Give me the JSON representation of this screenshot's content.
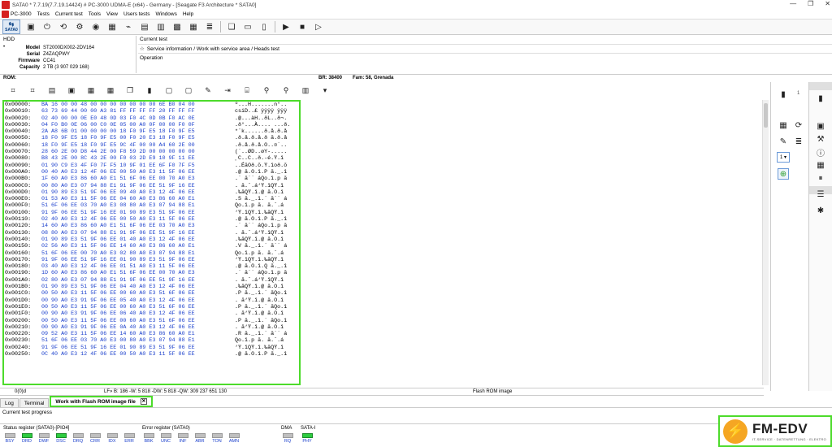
{
  "window": {
    "title": "SATA0 * 7.7.19(7.7.19.14424) # PC-3000 UDMA-E (x64) - Germany - [Seagate F3 Architecture * SATA0]",
    "controls": [
      "—",
      "❐",
      "✕"
    ]
  },
  "menu": {
    "logo_label": "PC-3000",
    "items": [
      "Tests",
      "Current test",
      "Tools",
      "View",
      "Users tests",
      "Windows",
      "Help"
    ]
  },
  "toolbar": {
    "sata_label": "SATA0"
  },
  "drive": {
    "section": "HDD",
    "model_label": "Model",
    "model": "ST2000DX002-2DV164",
    "serial_label": "Serial",
    "serial": "Z4ZAQPWY",
    "firmware_label": "Firmware",
    "firmware": "CC41",
    "capacity_label": "Capacity",
    "capacity": "2 TB (3 907 029 168)"
  },
  "current_test": {
    "label": "Current test",
    "path": "Service information / Work with service area / Heads test",
    "operation_label": "Operation"
  },
  "rom_bar": {
    "label": "ROM:",
    "br": "BR: 38400",
    "fam": "Fam: 58, Grenada"
  },
  "hex": {
    "rows": [
      {
        "addr": "0x00000:",
        "bytes": "BA 16 00 00 48 00 00 00 00 00 00 00 6E B0 04 00",
        "ascii": "º...H.......n°.."
      },
      {
        "addr": "0x00010:",
        "bytes": "63 73 69 44 00 00 A3 81 FF FF FF FF 20 FF FF FF",
        "ascii": "csiD..£ ÿÿÿÿ ÿÿÿ"
      },
      {
        "addr": "0x00020:",
        "bytes": "02 40 00 00 0E E0 48 0D 03 F0 4C 0D 0B F0 AC 0E",
        "ascii": ".@...àH..ðL..ð¬."
      },
      {
        "addr": "0x00030:",
        "bytes": "04 F0 B0 0E 06 00 C0 0E 05 00 A0 0F 00 00 F0 0F",
        "ascii": ".ð°...À.... ...ð."
      },
      {
        "addr": "0x00040:",
        "bytes": "2A A8 6B 01 00 00 00 00 18 F0 9F E5 18 F0 9F E5",
        "ascii": "*¨k......ð.å.ð.å"
      },
      {
        "addr": "0x00050:",
        "bytes": "18 F0 9F E5 18 F0 9F E5 00 F0 20 E3 18 F0 9F E5",
        "ascii": ".ð.å.ð.å.ð ã.ð.å"
      },
      {
        "addr": "0x00060:",
        "bytes": "18 F0 9F E5 18 F0 9F E5 9C 4F 00 00 A4 60 2E 00",
        "ascii": ".ð.å.ð.å.O..¤`.."
      },
      {
        "addr": "0x00070:",
        "bytes": "28 60 2E 00 D8 44 2E 00 F8 59 2D 00 00 00 00 00",
        "ascii": "(`..ØD..øY-....."
      },
      {
        "addr": "0x00080:",
        "bytes": "B8 43 2E 00 8C 43 2E 00 F0 03 2D E9 10 9F 11 EE",
        "ascii": "¸C..C..ð.-é.Ÿ.î"
      },
      {
        "addr": "0x00090:",
        "bytes": "01 90 C9 E3 4F F0 7F F5 10 9F 01 EE 6F F0 7F F5",
        "ascii": "..ÉãOð.õ.Ÿ.îoð.õ"
      },
      {
        "addr": "0x000A0:",
        "bytes": "00 40 A0 E3 12 4F 06 EE 00 50 A0 E3 11 5F 06 EE",
        "ascii": ".@ ã.O.î.P ã._.î"
      },
      {
        "addr": "0x000B0:",
        "bytes": "1F 60 A0 E3 86 60 A0 E1 51 6F 06 EE 00 70 A0 E3",
        "ascii": ".` ã`` áQo.î.p ã"
      },
      {
        "addr": "0x000C0:",
        "bytes": "00 80 A0 E3 07 94 88 E1 91 9F 06 EE 51 9F 16 EE",
        "ascii": ". ã.ˆ.á‘Ÿ.îQŸ.î"
      },
      {
        "addr": "0x000D0:",
        "bytes": "01 90 89 E3 51 9F 06 EE 09 40 A0 E3 12 4F 06 EE",
        "ascii": ".‰ãQŸ.î.@ ã.O.î"
      },
      {
        "addr": "0x000E0:",
        "bytes": "01 53 A0 E3 11 5F 06 EE 04 60 A0 E3 86 60 A0 E1",
        "ascii": ".S ã._.î.` ã`` á"
      },
      {
        "addr": "0x000F0:",
        "bytes": "51 6F 06 EE 03 70 A0 E3 08 80 A0 E3 07 94 88 E1",
        "ascii": "Qo.î.p ã. ã.ˆ.á"
      },
      {
        "addr": "0x00100:",
        "bytes": "91 9F 06 EE 51 9F 16 EE 01 90 89 E3 51 9F 06 EE",
        "ascii": "‘Ÿ.îQŸ.î.‰ãQŸ.î"
      },
      {
        "addr": "0x00110:",
        "bytes": "02 40 A0 E3 12 4F 06 EE 00 50 A0 E3 11 5F 06 EE",
        "ascii": ".@ ã.O.î.P ã._.î"
      },
      {
        "addr": "0x00120:",
        "bytes": "14 60 A0 E3 86 60 A0 E1 51 6F 06 EE 03 70 A0 E3",
        "ascii": ".` ã`` áQo.î.p ã"
      },
      {
        "addr": "0x00130:",
        "bytes": "08 80 A0 E3 07 94 88 E1 91 9F 06 EE 51 9F 16 EE",
        "ascii": ". ã.ˆ.á‘Ÿ.îQŸ.î"
      },
      {
        "addr": "0x00140:",
        "bytes": "01 90 89 E3 51 9F 06 EE 01 40 A0 E3 12 4F 06 EE",
        "ascii": ".‰ãQŸ.î.@ ã.O.î"
      },
      {
        "addr": "0x00150:",
        "bytes": "02 56 A0 E3 11 5F 06 EE 14 60 A0 E3 86 60 A0 E1",
        "ascii": ".V ã._.î.` ã`` á"
      },
      {
        "addr": "0x00160:",
        "bytes": "51 6F 06 EE 00 70 A0 E3 02 80 A0 E3 07 94 88 E1",
        "ascii": "Qo.î.p ã. ã.ˆ.á"
      },
      {
        "addr": "0x00170:",
        "bytes": "91 9F 06 EE 51 9F 16 EE 01 90 89 E3 51 9F 06 EE",
        "ascii": "‘Ÿ.îQŸ.î.‰ãQŸ.î"
      },
      {
        "addr": "0x00180:",
        "bytes": "03 40 A0 E3 12 4F 06 EE 01 51 A0 E3 11 5F 06 EE",
        "ascii": ".@ ã.O.î.Q ã._.î"
      },
      {
        "addr": "0x00190:",
        "bytes": "1D 60 A0 E3 86 60 A0 E1 51 6F 06 EE 00 70 A0 E3",
        "ascii": ".` ã`` áQo.î.p ã"
      },
      {
        "addr": "0x001A0:",
        "bytes": "02 80 A0 E3 07 94 88 E1 91 9F 06 EE 51 9F 16 EE",
        "ascii": ". ã.ˆ.á‘Ÿ.îQŸ.î"
      },
      {
        "addr": "0x001B0:",
        "bytes": "01 90 89 E3 51 9F 06 EE 04 40 A0 E3 12 4F 06 EE",
        "ascii": ".‰ãQŸ.î.@ ã.O.î"
      },
      {
        "addr": "0x001C0:",
        "bytes": "00 50 A0 E3 11 5F 06 EE 00 60 A0 E3 51 6F 06 EE",
        "ascii": ".P ã._.î.` ãQo.î"
      },
      {
        "addr": "0x001D0:",
        "bytes": "00 90 A0 E3 91 9F 06 EE 05 40 A0 E3 12 4F 06 EE",
        "ascii": ". ã‘Ÿ.î.@ ã.O.î"
      },
      {
        "addr": "0x001E0:",
        "bytes": "00 50 A0 E3 11 5F 06 EE 00 60 A0 E3 51 6F 06 EE",
        "ascii": ".P ã._.î.` ãQo.î"
      },
      {
        "addr": "0x001F0:",
        "bytes": "00 90 A0 E3 91 9F 06 EE 06 40 A0 E3 12 4F 06 EE",
        "ascii": ". ã‘Ÿ.î.@ ã.O.î"
      },
      {
        "addr": "0x00200:",
        "bytes": "00 50 A0 E3 11 5F 06 EE 00 60 A0 E3 51 6F 06 EE",
        "ascii": ".P ã._.î.` ãQo.î"
      },
      {
        "addr": "0x00210:",
        "bytes": "00 90 A0 E3 91 9F 06 EE 0A 40 A0 E3 12 4F 06 EE",
        "ascii": ". ã‘Ÿ.î.@ ã.O.î"
      },
      {
        "addr": "0x00220:",
        "bytes": "09 52 A0 E3 11 5F 06 EE 14 60 A0 E3 86 60 A0 E1",
        "ascii": ".R ã._.î.` ã`` á"
      },
      {
        "addr": "0x00230:",
        "bytes": "51 6F 06 EE 03 70 A0 E3 00 80 A0 E3 07 94 88 E1",
        "ascii": "Qo.î.p ã. ã.ˆ.á"
      },
      {
        "addr": "0x00240:",
        "bytes": "91 9F 06 EE 51 9F 16 EE 01 90 89 E3 51 9F 06 EE",
        "ascii": "‘Ÿ.îQŸ.î.‰ãQŸ.î"
      },
      {
        "addr": "0x00250:",
        "bytes": "0C 40 A0 E3 12 4F 06 EE 00 50 A0 E3 11 5F 06 EE",
        "ascii": ".@ ã.O.î.P ã._.î"
      }
    ]
  },
  "editor_status": {
    "position": "0(0)d",
    "stats": "LF» B: 186 -W: 5 818 -DW: 5 818 -QW: 309 237 651 130",
    "file": "Flash ROM image"
  },
  "side_panel": {
    "page_number": "1",
    "selector_value": "1 ▾"
  },
  "tabs": [
    "Log",
    "Terminal",
    "Work with Flash ROM image file"
  ],
  "tab_close": "✕",
  "progress_label": "Current test progress",
  "registers": {
    "status_title": "Status register (SATA0)-[PIO4]",
    "error_title": "Error register (SATA0)",
    "dma_title": "DMA",
    "sata_title": "SATA-I",
    "status": [
      {
        "name": "BSY",
        "on": false
      },
      {
        "name": "DRD",
        "on": true
      },
      {
        "name": "DWF",
        "on": false
      },
      {
        "name": "DSC",
        "on": true
      },
      {
        "name": "DRQ",
        "on": false
      },
      {
        "name": "CRR",
        "on": false
      },
      {
        "name": "IDX",
        "on": false
      },
      {
        "name": "ERR",
        "on": false
      }
    ],
    "error": [
      {
        "name": "BBK",
        "on": false
      },
      {
        "name": "UNC",
        "on": false
      },
      {
        "name": "INF",
        "on": false
      },
      {
        "name": "ABR",
        "on": false
      },
      {
        "name": "TON",
        "on": false
      },
      {
        "name": "AMN",
        "on": false
      }
    ],
    "dma": [
      {
        "name": "RQ",
        "on": false
      }
    ],
    "sata": [
      {
        "name": "PHY",
        "on": true
      }
    ]
  },
  "branding": {
    "name": "FM-EDV",
    "tagline": "IT-SERVICE · DATENRETTUNG · ELEKTRO"
  },
  "colors": {
    "highlight": "#4ddb2b",
    "hex_bytes": "#1a3fcc",
    "led_on": "#2ecc40",
    "led_off": "#bfbfbf",
    "brand_orange": "#f5a623"
  }
}
